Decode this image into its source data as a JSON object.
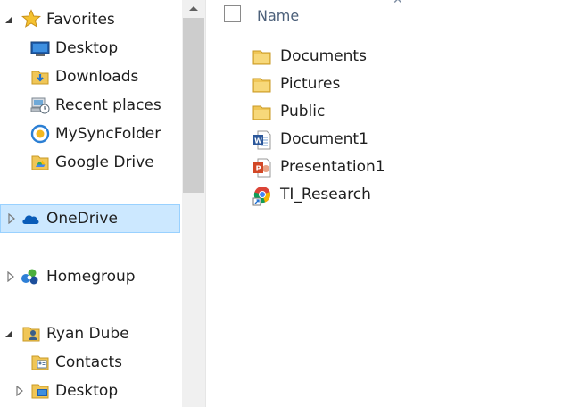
{
  "nav": {
    "favorites": "Favorites",
    "desktop": "Desktop",
    "downloads": "Downloads",
    "recent_places": "Recent places",
    "mysyncfolder": "MySyncFolder",
    "google_drive": "Google Drive",
    "onedrive": "OneDrive",
    "homegroup": "Homegroup",
    "user": "Ryan Dube",
    "contacts": "Contacts",
    "user_desktop": "Desktop"
  },
  "content": {
    "column_header": "Name",
    "files": [
      {
        "name": "Documents",
        "icon": "folder-icon"
      },
      {
        "name": "Pictures",
        "icon": "folder-icon"
      },
      {
        "name": "Public",
        "icon": "folder-icon"
      },
      {
        "name": "Document1",
        "icon": "word-document-icon"
      },
      {
        "name": "Presentation1",
        "icon": "powerpoint-icon"
      },
      {
        "name": "TI_Research",
        "icon": "chrome-shortcut-icon"
      }
    ]
  },
  "colors": {
    "selection_bg": "#cce8ff",
    "selection_border": "#99d1ff",
    "header_text": "#4c607a"
  }
}
